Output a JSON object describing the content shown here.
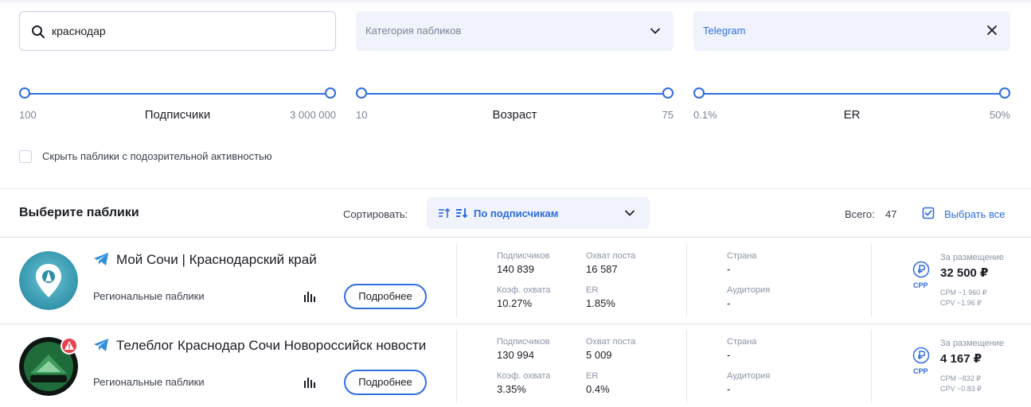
{
  "filters": {
    "search_value": "краснодар",
    "category_placeholder": "Категория пабликов",
    "platform_value": "Telegram",
    "hide_suspicious_label": "Скрыть паблики с подозрительной активностью"
  },
  "sliders": [
    {
      "label": "Подписчики",
      "min": "100",
      "max": "3 000 000"
    },
    {
      "label": "Возраст",
      "min": "10",
      "max": "75"
    },
    {
      "label": "ER",
      "min": "0.1%",
      "max": "50%"
    }
  ],
  "toolbar": {
    "title": "Выберите паблики",
    "sort_label": "Сортировать:",
    "sort_value": "По подписчикам",
    "total_label": "Всего:",
    "total_value": "47",
    "select_all_label": "Выбрать все"
  },
  "labels": {
    "subscribers": "Подписчиков",
    "reach": "Охват поста",
    "reach_coef": "Коэф. охвата",
    "er": "ER",
    "country": "Страна",
    "audience": "Аудитория",
    "price": "За размещение",
    "more": "Подробнее",
    "cpp": "CPP"
  },
  "publics": [
    {
      "name": "Мой Сочи | Краснодарский край",
      "category": "Региональные паблики",
      "subscribers": "140 839",
      "reach": "16 587",
      "reach_coef": "10.27%",
      "er": "1.85%",
      "country": "-",
      "audience": "-",
      "price": "32 500 ₽",
      "cpm": "CPM ~1 960 ₽",
      "cpv": "CPV ~1.96 ₽",
      "warning": false
    },
    {
      "name": "Телеблог Краснодар Сочи Новороссийск новости",
      "category": "Региональные паблики",
      "subscribers": "130 994",
      "reach": "5 009",
      "reach_coef": "3.35%",
      "er": "0.4%",
      "country": "-",
      "audience": "-",
      "price": "4 167 ₽",
      "cpm": "CPM ~832 ₽",
      "cpv": "CPV ~0.83 ₽",
      "warning": true
    }
  ],
  "colors": {
    "accent": "#2f6de1",
    "danger": "#e6414c"
  }
}
